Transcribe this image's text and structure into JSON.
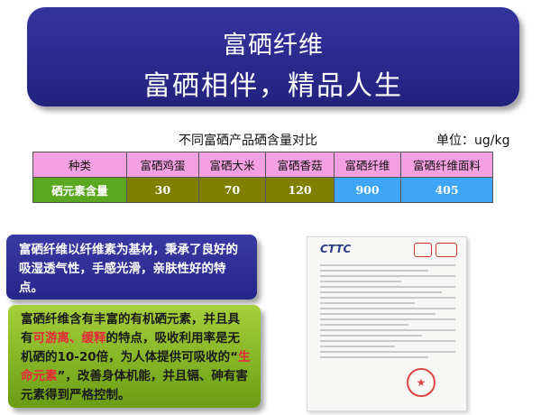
{
  "header": {
    "title": "富硒纤维",
    "slogan": "富硒相伴，精品人生"
  },
  "table": {
    "caption": "不同富硒产品硒含量对比",
    "unit": "单位：ug/kg",
    "header_label": "种类",
    "row_label": "硒元素含量",
    "products": [
      "富硒鸡蛋",
      "富硒大米",
      "富硒香菇",
      "富硒纤维",
      "富硒纤维面料"
    ],
    "values": [
      "30",
      "70",
      "120",
      "900",
      "405"
    ]
  },
  "text_boxes": {
    "intro": "富硒纤维以纤维素为基材，秉承了良好的吸湿透气性，手感光滑，亲肤性好的特点。",
    "detail_part1": "富硒纤维含有丰富的有机硒元素，并且具有",
    "detail_highlight1": "可游离、缓释",
    "detail_part2": "的特点，吸收利用率是无机硒的10-20倍，为人体提供可吸收的“",
    "detail_highlight2": "生命元素",
    "detail_part3": "”，改善身体机能，并且镉、砷有害元素得到严格控制。"
  },
  "certificate": {
    "logo_text": "CTTC"
  },
  "colors": {
    "banner": "#2a2a8c",
    "header_row": "#f5a0e3",
    "value_row": "#808000",
    "row_label": "#5aa820",
    "highlight_cells": "#3fa5f8",
    "green_box": "#8cc02a",
    "highlight_text": "#e8283b"
  }
}
